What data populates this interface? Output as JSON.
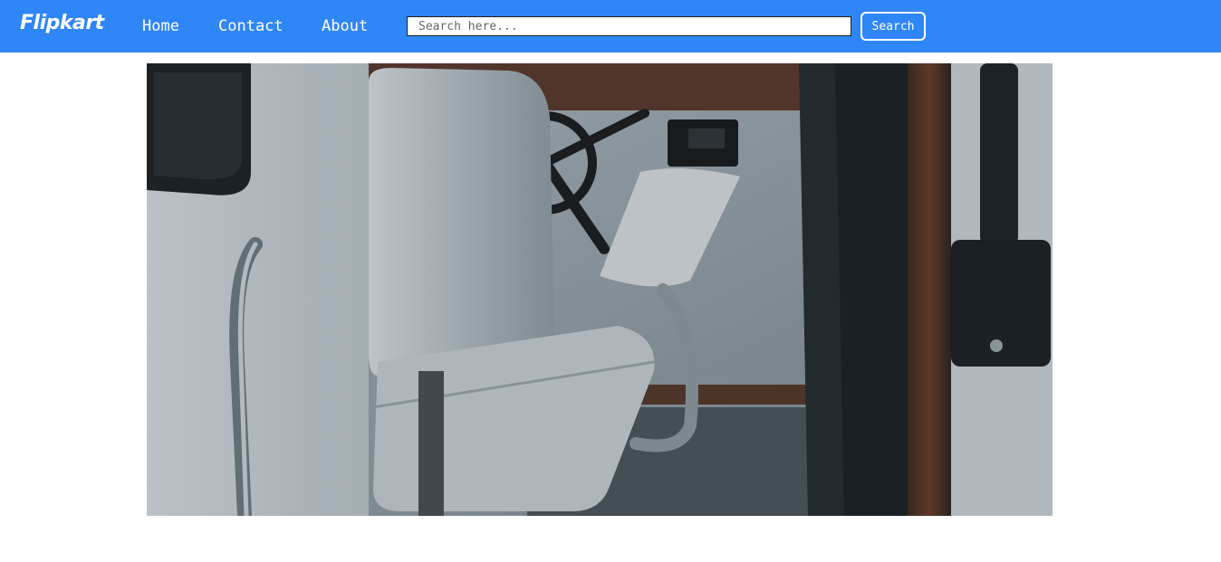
{
  "navbar": {
    "logo": "Flipkart",
    "links": [
      {
        "label": "Home"
      },
      {
        "label": "Contact"
      },
      {
        "label": "About"
      }
    ],
    "search": {
      "placeholder": "Search here...",
      "button_label": "Search"
    },
    "background_color": "#2f86f7"
  },
  "hero_image": {
    "subject": "boat helm seat"
  }
}
